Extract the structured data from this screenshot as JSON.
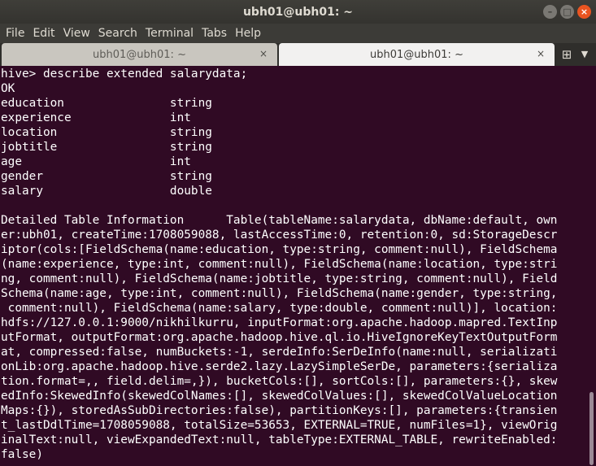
{
  "window": {
    "title": "ubh01@ubh01: ~",
    "minimize": "–",
    "maximize": "□",
    "close": "×"
  },
  "menu": [
    "File",
    "Edit",
    "View",
    "Search",
    "Terminal",
    "Tabs",
    "Help"
  ],
  "tabs": [
    {
      "label": "ubh01@ubh01: ~",
      "active": false,
      "close": "×"
    },
    {
      "label": "ubh01@ubh01: ~",
      "active": true,
      "close": "×"
    }
  ],
  "tabbar": {
    "new_tab_icon": "⊞",
    "menu_icon": "▼"
  },
  "terminal": {
    "lines": [
      "hive> describe extended salarydata;",
      "OK",
      "education               string",
      "experience              int",
      "location                string",
      "jobtitle                string",
      "age                     int",
      "gender                  string",
      "salary                  double",
      "",
      "Detailed Table Information      Table(tableName:salarydata, dbName:default, own",
      "er:ubh01, createTime:1708059088, lastAccessTime:0, retention:0, sd:StorageDescr",
      "iptor(cols:[FieldSchema(name:education, type:string, comment:null), FieldSchema",
      "(name:experience, type:int, comment:null), FieldSchema(name:location, type:stri",
      "ng, comment:null), FieldSchema(name:jobtitle, type:string, comment:null), Field",
      "Schema(name:age, type:int, comment:null), FieldSchema(name:gender, type:string,",
      " comment:null), FieldSchema(name:salary, type:double, comment:null)], location:",
      "hdfs://127.0.0.1:9000/nikhilkurru, inputFormat:org.apache.hadoop.mapred.TextInp",
      "utFormat, outputFormat:org.apache.hadoop.hive.ql.io.HiveIgnoreKeyTextOutputForm",
      "at, compressed:false, numBuckets:-1, serdeInfo:SerDeInfo(name:null, serializati",
      "onLib:org.apache.hadoop.hive.serde2.lazy.LazySimpleSerDe, parameters:{serializa",
      "tion.format=,, field.delim=,}), bucketCols:[], sortCols:[], parameters:{}, skew",
      "edInfo:SkewedInfo(skewedColNames:[], skewedColValues:[], skewedColValueLocation",
      "Maps:{}), storedAsSubDirectories:false), partitionKeys:[], parameters:{transien",
      "t_lastDdlTime=1708059088, totalSize=53653, EXTERNAL=TRUE, numFiles=1}, viewOrig",
      "inalText:null, viewExpandedText:null, tableType:EXTERNAL_TABLE, rewriteEnabled:",
      "false)"
    ]
  },
  "colors": {
    "terminal_bg": "#300a24",
    "terminal_fg": "#ffffff",
    "titlebar_bg": "#3c3b37",
    "close_button": "#e95420"
  }
}
